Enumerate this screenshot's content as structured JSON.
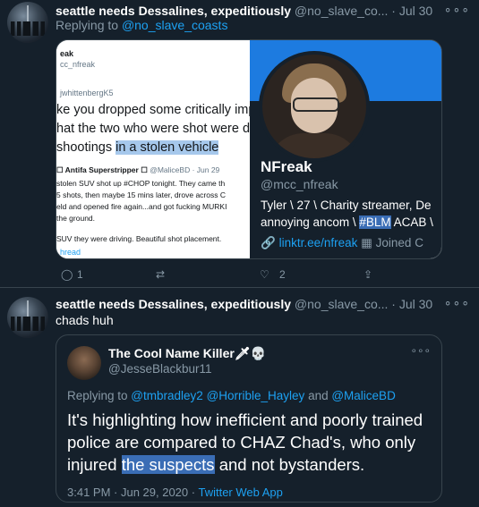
{
  "tweet1": {
    "name": "seattle needs Dessalines, expeditiously",
    "handle": "@no_slave_co...",
    "date": "Jul 30",
    "more": "∘∘∘",
    "replying_prefix": "Replying to ",
    "replying_to": "@no_slave_coasts",
    "screenshot": {
      "top_name": "eak",
      "top_handle": "cc_nfreak",
      "mention": "jwhittenbergK5",
      "line1": "ke you dropped some critically impo",
      "line2": "hat the two who were shot were do",
      "line3_prefix": "shootings ",
      "line3_highlight": "in a stolen vehicle",
      "inner_name": "☐ Antifa Superstripper ☐",
      "inner_handle": "@MaliceBD · Jun 29",
      "inner_lines": [
        "stolen SUV shot up #CHOP tonight. They came th",
        "5 shots, then maybe 15 mins later, drove across C",
        "eld and opened fire again...and got fucking MURKI",
        "the ground.",
        "",
        "SUV they were driving. Beautiful shot placement."
      ],
      "thread": "hread"
    },
    "profile": {
      "name": "NFreak",
      "handle": "@mcc_nfreak",
      "bio_line1": "Tyler \\ 27 \\ Charity streamer, De",
      "bio_line2_prefix": "annoying ancom \\ ",
      "bio_tag": "#BLM",
      "bio_line2_suffix": " ACAB \\",
      "link": "linktr.ee/nfreak",
      "joined": "Joined C"
    },
    "actions": {
      "replies": "1",
      "likes": "2"
    }
  },
  "tweet2": {
    "name": "seattle needs Dessalines, expeditiously",
    "handle": "@no_slave_co...",
    "date": "Jul 30",
    "more": "∘∘∘",
    "text": "chads huh",
    "quote": {
      "name": "The Cool Name Killer🗡💀",
      "handle": "@JesseBlackbur11",
      "more": "∘∘∘",
      "replying_prefix": "Replying to ",
      "replying_to_1": "@tmbradley2",
      "replying_to_2": "@Horrible_Hayley",
      "replying_and": " and ",
      "replying_to_3": "@MaliceBD",
      "text_1": "It's highlighting how inefficient and poorly trained police are compared to CHAZ Chad's, who only injured ",
      "text_highlight": "the suspects",
      "text_2": " and not bystanders.",
      "time": "3:41 PM · Jun 29, 2020 · ",
      "source": "Twitter Web App"
    }
  }
}
